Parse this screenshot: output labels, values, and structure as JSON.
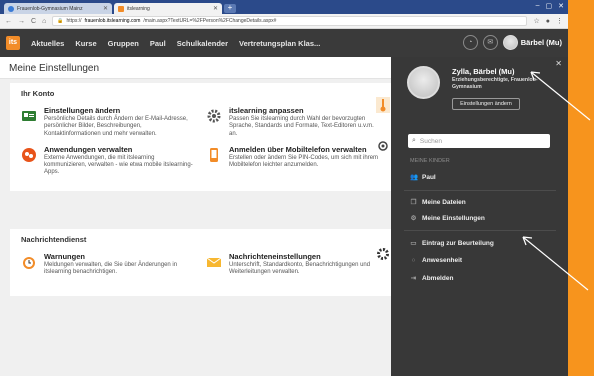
{
  "browser": {
    "tabs": [
      {
        "label": "Frauenlob-Gymnasium Mainz",
        "favicon": "globe-icon",
        "active": false
      },
      {
        "label": "itslearning",
        "favicon": "itslearning-logo-icon",
        "active": true
      }
    ],
    "url_prefix": "https://",
    "url_domain": "frauenlob.itslearning.com",
    "url_path": "/main.aspx?TextURL=%2FPerson%2FChangeDetails.aspx#"
  },
  "appbar": {
    "logo": "its",
    "nav": [
      "Aktuelles",
      "Kurse",
      "Gruppen",
      "Paul",
      "Schulkalender",
      "Vertretungsplan Klas..."
    ],
    "user_name": "Bärbel (Mu)"
  },
  "page": {
    "title": "Meine Einstellungen",
    "sections": [
      {
        "heading": "Ihr Konto",
        "items": [
          {
            "title": "Einstellungen ändern",
            "desc": "Persönliche Details durch Ändern der E-Mail-Adresse, persönlicher Bilder, Beschreibungen, Kontaktinformationen und mehr verwalten.",
            "icon": "settings-card-icon"
          },
          {
            "title": "itslearning anpassen",
            "desc": "Passen Sie itslearning durch Wahl der bevorzugten Sprache, Standards und Formate, Text-Editoren u.v.m. an.",
            "icon": "gear-icon"
          },
          {
            "title": "Anwendungen verwalten",
            "desc": "Externe Anwendungen, die mit itslearning kommunizieren, verwalten - wie etwa mobile itslearning-Apps.",
            "icon": "apps-icon"
          },
          {
            "title": "Anmelden über Mobiltelefon verwalten",
            "desc": "Erstellen oder ändern Sie PIN-Codes, um sich mit ihrem Mobiltelefon leichter anzumelden.",
            "icon": "mobile-phone-icon"
          }
        ]
      },
      {
        "heading": "Nachrichtendienst",
        "items": [
          {
            "title": "Warnungen",
            "desc": "Meldungen verwalten, die Sie über Änderungen in itslearning benachrichtigen.",
            "icon": "warning-clock-icon"
          },
          {
            "title": "Nachrichteneinstellungen",
            "desc": "Unterschrift, Standardkonto, Benachrichtigungen und Weiterleitungen verwalten.",
            "icon": "envelope-icon"
          }
        ]
      }
    ]
  },
  "panel": {
    "name": "Zylla, Bärbel (Mu)",
    "role": "Erziehungsberechtigte, Frauenlob-Gymnasium",
    "change_settings": "Einstellungen ändern",
    "search_placeholder": "Suchen",
    "section_children": "MEINE KINDER",
    "child": "Paul",
    "links": [
      "Meine Dateien",
      "Meine Einstellungen"
    ],
    "links2": [
      "Eintrag zur Beurteilung",
      "Anwesenheit",
      "Abmelden"
    ]
  },
  "colors": {
    "accent": "#f7941d",
    "appbar": "#3a3a3a",
    "panel": "#383838"
  }
}
